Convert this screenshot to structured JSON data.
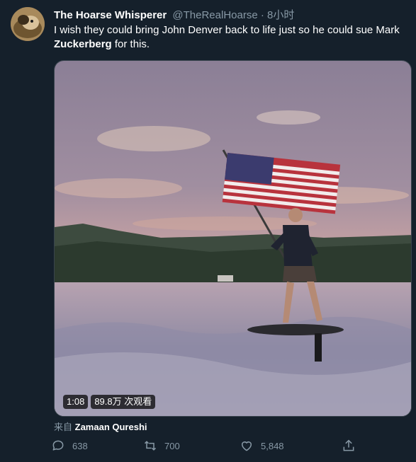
{
  "tweet": {
    "display_name": "The Hoarse Whisperer",
    "handle": "@TheRealHoarse",
    "separator": "·",
    "time": "8小时",
    "text_before_bold": "I wish they could bring John Denver back to life just so he could sue Mark ",
    "text_bold": "Zuckerberg",
    "text_after_bold": " for this."
  },
  "media": {
    "duration": "1:08",
    "views": "89.8万 次观看"
  },
  "source": {
    "prefix": "来自",
    "name": "Zamaan Qureshi"
  },
  "actions": {
    "reply_count": "638",
    "retweet_count": "700",
    "like_count": "5,848"
  },
  "colors": {
    "background": "#15202b",
    "secondary_text": "#8899a6",
    "primary_text": "#ffffff"
  }
}
